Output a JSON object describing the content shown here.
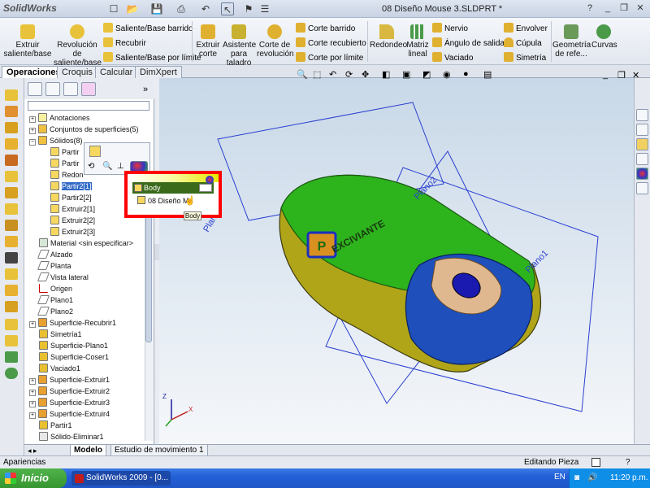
{
  "app": {
    "name": "SolidWorks",
    "doc_title": "08 Diseño Mouse 3.SLDPRT *"
  },
  "ribbon": {
    "extruir_saliente": "Extruir saliente/base",
    "revolucion_saliente": "Revolución de saliente/base",
    "saliente_barrido": "Saliente/Base barrido",
    "recubrir": "Recubrir",
    "saliente_limite": "Saliente/Base por límite",
    "extruir_corte": "Extruir corte",
    "asistente_taladro": "Asistente para taladro",
    "corte_revolucion": "Corte de revolución",
    "corte_barrido": "Corte barrido",
    "corte_recubierto": "Corte recubierto",
    "corte_limite": "Corte por límite",
    "redondeo": "Redondeo",
    "matriz_lineal": "Matriz lineal",
    "nervio": "Nervio",
    "angulo_salida": "Ángulo de salida",
    "vaciado": "Vaciado",
    "envolver": "Envolver",
    "cupula": "Cúpula",
    "simetria": "Simetría",
    "geometria": "Geometría de refe...",
    "curvas": "Curvas"
  },
  "tabs": [
    "Operaciones",
    "Croquis",
    "Calcular",
    "DimXpert"
  ],
  "tree": {
    "anotaciones": "Anotaciones",
    "conjuntos": "Conjuntos de superficies(5)",
    "solidos": "Sólidos(8)",
    "partir1": "Partir",
    "partir2": "Partir",
    "redon": "Redon",
    "partir2_1": "Partir2[1]",
    "partir2_2": "Partir2[2]",
    "extruir2_1": "Extruir2[1]",
    "extruir2_2": "Extruir2[2]",
    "extruir2_3": "Extruir2[3]",
    "material": "Material <sin especificar>",
    "alzado": "Alzado",
    "planta": "Planta",
    "vista_lateral": "Vista lateral",
    "origen": "Origen",
    "plano1": "Plano1",
    "plano2": "Plano2",
    "sup_recubrir1": "Superficie-Recubrir1",
    "simetria1": "Simetría1",
    "sup_plano1": "Superficie-Plano1",
    "sup_coser1": "Superficie-Coser1",
    "vaciado1": "Vaciado1",
    "sup_extruir1": "Superficie-Extruir1",
    "sup_extruir2": "Superficie-Extruir2",
    "sup_extruir3": "Superficie-Extruir3",
    "sup_extruir4": "Superficie-Extruir4",
    "partir1b": "Partir1",
    "solido_eliminar": "Sólido-Eliminar1"
  },
  "popup": {
    "body": "Body",
    "diseno": "08 Diseño M",
    "tooltip": "Body"
  },
  "viewport": {
    "plano1": "Plano1",
    "plano2": "Plano2",
    "plano3": "Plano3",
    "emboss": "EXCIVIANTE",
    "axis_z": "Z",
    "axis_x": "X"
  },
  "bottom_tabs": [
    "Modelo",
    "Estudio de movimiento 1"
  ],
  "status": {
    "left": "Apariencias",
    "mid": "Editando Pieza"
  },
  "taskbar": {
    "start": "Inicio",
    "task": "SolidWorks 2009 - [0...",
    "lang": "EN",
    "clock": "11:20 p.m."
  }
}
